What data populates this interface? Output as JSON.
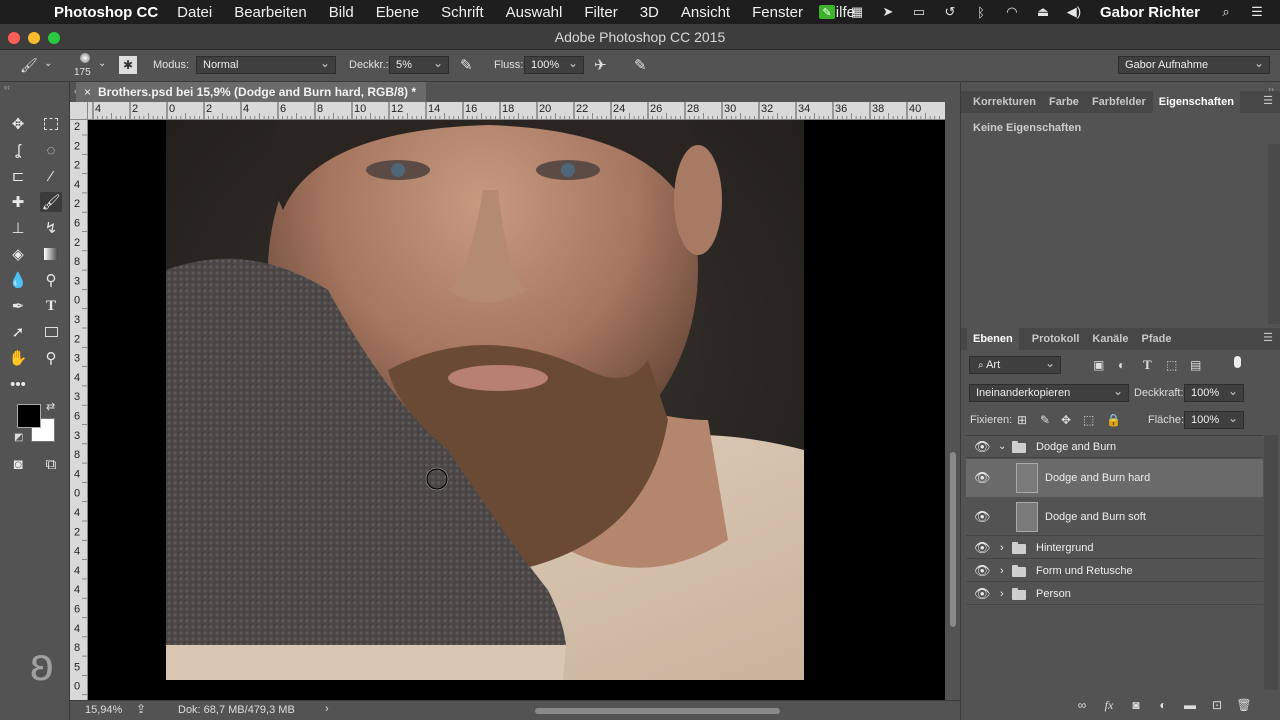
{
  "menubar": {
    "app": "Photoshop CC",
    "items": [
      "Datei",
      "Bearbeiten",
      "Bild",
      "Ebene",
      "Schrift",
      "Auswahl",
      "Filter",
      "3D",
      "Ansicht",
      "Fenster",
      "Hilfe"
    ],
    "user": "Gabor Richter"
  },
  "window": {
    "title": "Adobe Photoshop CC 2015"
  },
  "options": {
    "brush_size": "175",
    "mode_label": "Modus:",
    "mode_value": "Normal",
    "opacity_label": "Deckkr.:",
    "opacity_value": "5%",
    "flow_label": "Fluss:",
    "flow_value": "100%",
    "workspace": "Gabor Aufnahme"
  },
  "document": {
    "tab_title": "Brothers.psd bei 15,9% (Dodge and Burn hard, RGB/8) *",
    "h_ruler_labels": [
      "4",
      "2",
      "0",
      "2",
      "4",
      "6",
      "8",
      "10",
      "12",
      "14",
      "16",
      "18",
      "20",
      "22",
      "24",
      "26",
      "28",
      "30",
      "32",
      "34",
      "36",
      "38",
      "40"
    ],
    "v_ruler_labels": [
      "2",
      "2",
      "2",
      "4",
      "2",
      "6",
      "2",
      "8",
      "3",
      "0",
      "3",
      "2",
      "3",
      "4",
      "3",
      "6",
      "3",
      "8",
      "4",
      "0",
      "4",
      "2",
      "4",
      "4",
      "4",
      "6",
      "4",
      "8",
      "5",
      "0"
    ]
  },
  "statusbar": {
    "zoom": "15,94%",
    "doc": "Dok: 68,7 MB/479,3 MB"
  },
  "properties_panel": {
    "tabs": [
      "Korrekturen",
      "Farbe",
      "Farbfelder",
      "Eigenschaften"
    ],
    "active_tab": "Eigenschaften",
    "content": "Keine Eigenschaften"
  },
  "layers_panel": {
    "tabs": [
      "Ebenen",
      "Protokoll",
      "Kanäle",
      "Pfade"
    ],
    "active_tab": "Ebenen",
    "filter": "Art",
    "blend_mode": "Ineinanderkopieren",
    "opacity_label": "Deckkraft:",
    "opacity_value": "100%",
    "lock_label": "Fixieren:",
    "fill_label": "Fläche:",
    "fill_value": "100%",
    "layers": [
      {
        "name": "Dodge and Burn",
        "type": "group",
        "expanded": true
      },
      {
        "name": "Dodge and Burn hard",
        "type": "layer",
        "selected": true
      },
      {
        "name": "Dodge and Burn soft",
        "type": "layer"
      },
      {
        "name": "Hintergrund",
        "type": "group"
      },
      {
        "name": "Form und Retusche",
        "type": "group"
      },
      {
        "name": "Person",
        "type": "group"
      }
    ]
  },
  "colors": {
    "foreground": "#000000",
    "background": "#ffffff",
    "accent": "#2a9fd8"
  }
}
